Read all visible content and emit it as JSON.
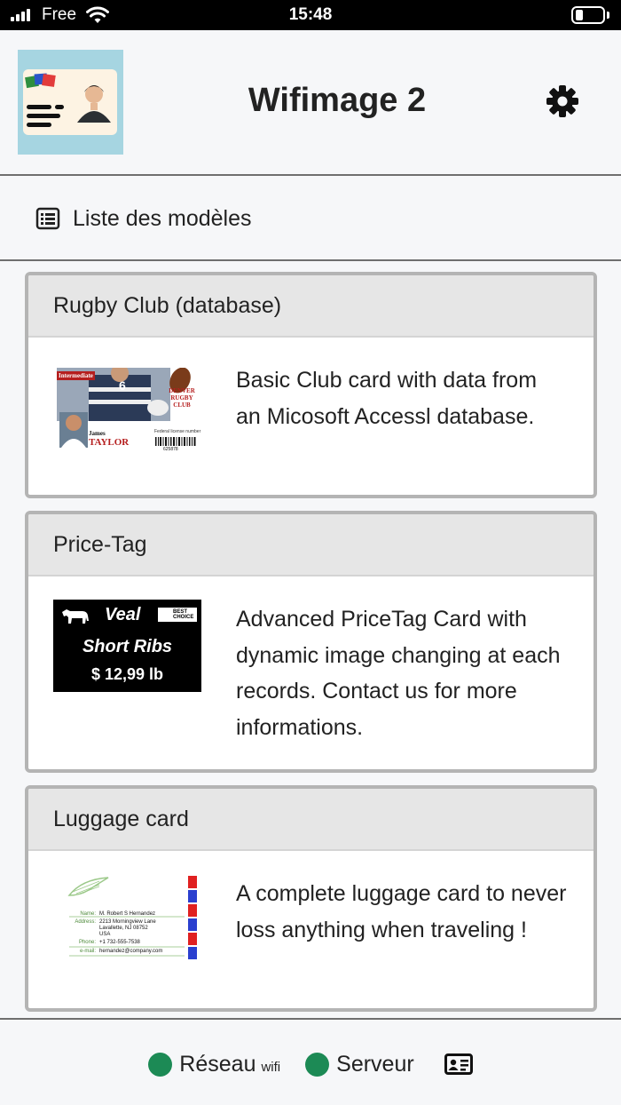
{
  "status_bar": {
    "carrier": "Free",
    "time": "15:48"
  },
  "header": {
    "title": "Wifimage 2",
    "logo_icon": "id-card-logo",
    "settings_icon": "gear-icon"
  },
  "nav": {
    "item_label": "Liste des modèles",
    "item_icon": "list-icon"
  },
  "templates": [
    {
      "title": "Rugby Club (database)",
      "description": "Basic Club card with data from an Micosoft Accessl database.",
      "thumb": {
        "badge": "Intermediate",
        "jersey_number": "6",
        "club_line1": "DENVER",
        "club_line2": "RUGBY",
        "club_line3": "CLUB",
        "first_name": "James",
        "last_name": "TAYLOR",
        "barcode_label": "Federal license number",
        "barcode_number": "625878"
      }
    },
    {
      "title": "Price-Tag",
      "description": "Advanced PriceTag Card with dynamic image changing at each records. Contact us for more informations.",
      "thumb": {
        "product": "Veal",
        "cut": "Short Ribs",
        "price": "$ 12,99 lb",
        "badge_line1": "BEST",
        "badge_line2": "CHOICE"
      }
    },
    {
      "title": "Luggage card",
      "description": "A complete luggage card to never loss anything when traveling !",
      "thumb": {
        "name_label": "Name:",
        "name": "M. Robert S Hernandez",
        "address_label": "Address:",
        "address_line1": "2213 Morningview Lane",
        "address_line2": "Lavallette, NJ 08752",
        "address_line3": "USA",
        "phone_label": "Phone:",
        "phone": "+1 732-555-7538",
        "email_label": "e-mail:",
        "email": "hernandez@company.com"
      }
    }
  ],
  "footer": {
    "network_label": "Réseau",
    "network_sub": "wifi",
    "server_label": "Serveur",
    "status_color": "#1c8a55"
  }
}
